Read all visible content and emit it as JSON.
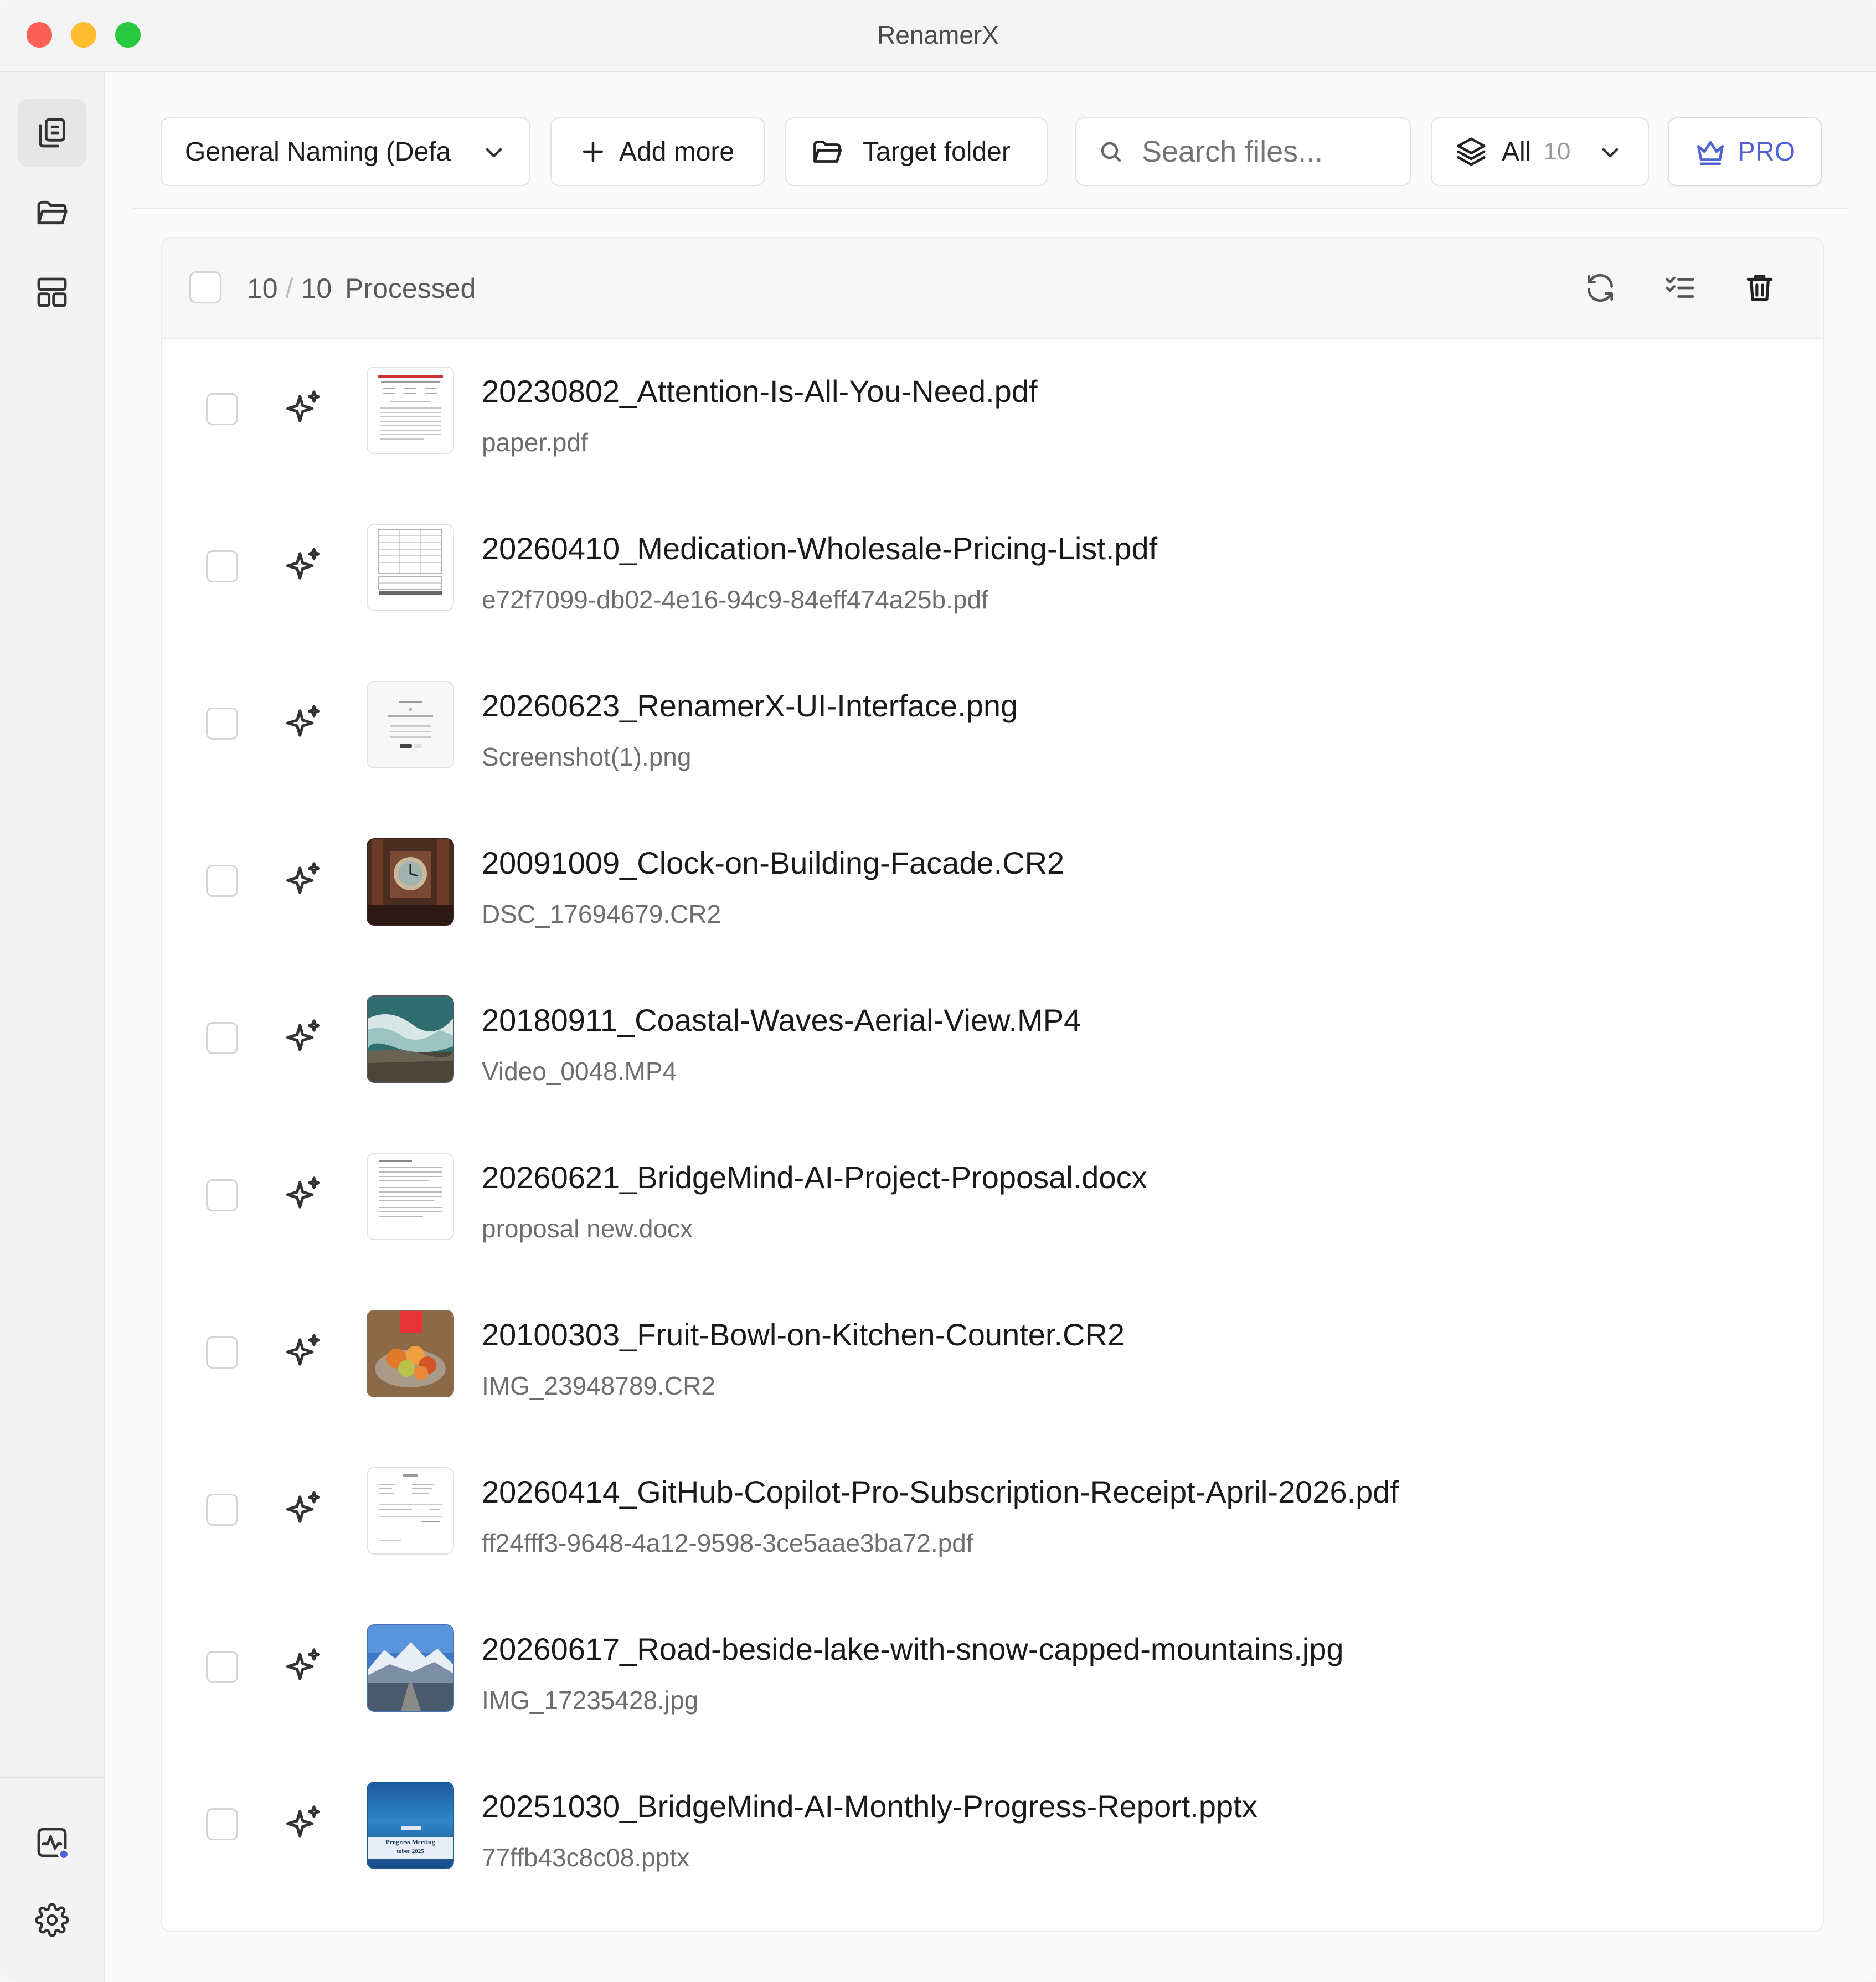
{
  "app": {
    "title": "RenamerX"
  },
  "colors": {
    "accent": "#4f63d2",
    "close": "#fe5f57",
    "minimize": "#febc2e",
    "maximize": "#28c840"
  },
  "sidebar": {
    "items": [
      {
        "icon": "files-icon",
        "active": true
      },
      {
        "icon": "folder-icon",
        "active": false
      },
      {
        "icon": "layout-icon",
        "active": false
      }
    ],
    "bottom_items": [
      {
        "icon": "activity-icon"
      },
      {
        "icon": "gear-icon"
      }
    ]
  },
  "toolbar": {
    "preset_label": "General Naming (Defa",
    "add_more_label": "Add more",
    "target_folder_label": "Target folder",
    "search_placeholder": "Search files...",
    "filter_label": "All",
    "filter_count": "10",
    "pro_label": "PRO"
  },
  "list_header": {
    "processed": "10",
    "total": "10",
    "status": "Processed"
  },
  "files": [
    {
      "new_name": "20230802_Attention-Is-All-You-Need.pdf",
      "old_name": "paper.pdf",
      "thumb": "doc"
    },
    {
      "new_name": "20260410_Medication-Wholesale-Pricing-List.pdf",
      "old_name": "e72f7099-db02-4e16-94c9-84eff474a25b.pdf",
      "thumb": "table"
    },
    {
      "new_name": "20260623_RenamerX-UI-Interface.png",
      "old_name": "Screenshot(1).png",
      "thumb": "ui"
    },
    {
      "new_name": "20091009_Clock-on-Building-Facade.CR2",
      "old_name": "DSC_17694679.CR2",
      "thumb": "clock"
    },
    {
      "new_name": "20180911_Coastal-Waves-Aerial-View.MP4",
      "old_name": "Video_0048.MP4",
      "thumb": "waves"
    },
    {
      "new_name": "20260621_BridgeMind-AI-Project-Proposal.docx",
      "old_name": "proposal new.docx",
      "thumb": "doc"
    },
    {
      "new_name": "20100303_Fruit-Bowl-on-Kitchen-Counter.CR2",
      "old_name": "IMG_23948789.CR2",
      "thumb": "fruit"
    },
    {
      "new_name": "20260414_GitHub-Copilot-Pro-Subscription-Receipt-April-2026.pdf",
      "old_name": "ff24fff3-9648-4a12-9598-3ce5aae3ba72.pdf",
      "thumb": "receipt"
    },
    {
      "new_name": "20260617_Road-beside-lake-with-snow-capped-mountains.jpg",
      "old_name": "IMG_17235428.jpg",
      "thumb": "mountain"
    },
    {
      "new_name": "20251030_BridgeMind-AI-Monthly-Progress-Report.pptx",
      "old_name": "77ffb43c8c08.pptx",
      "thumb": "slide",
      "thumb_text": [
        "Progress Meeting",
        "tober 2025"
      ]
    }
  ]
}
